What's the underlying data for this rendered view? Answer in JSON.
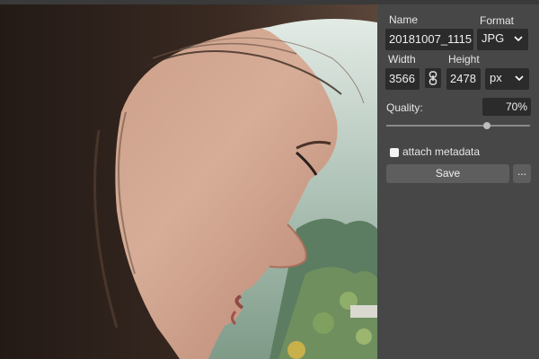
{
  "export_panel": {
    "name_label": "Name",
    "name_value": "20181007_1115",
    "format_label": "Format",
    "format_value": "JPG",
    "width_label": "Width",
    "width_value": "3566",
    "height_label": "Height",
    "height_value": "2478",
    "unit_value": "px",
    "quality_label": "Quality:",
    "quality_value": "70%",
    "quality_level": 0.7,
    "metadata_label": "attach metadata",
    "metadata_checked": false,
    "save_label": "Save",
    "more_label": "..."
  },
  "icons": {
    "format_dropdown": "chevron-down-icon",
    "unit_dropdown": "chevron-down-icon",
    "aspect_lock": "link-icon"
  }
}
